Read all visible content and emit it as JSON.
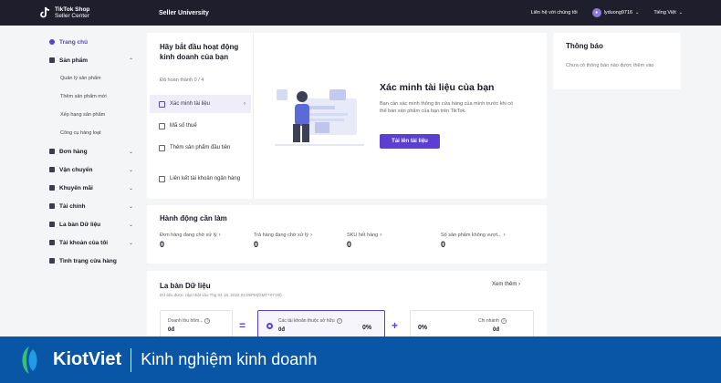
{
  "topbar": {
    "brand_line1": "TikTok Shop",
    "brand_line2": "Seller Center",
    "section": "Seller University",
    "contact": "Liên hệ với chúng tôi",
    "username": "lyduong9716",
    "language": "Tiếng Việt"
  },
  "sidebar": {
    "home": "Trang chủ",
    "products": "Sản phẩm",
    "product_sub": [
      "Quản lý sản phẩm",
      "Thêm sản phẩm mới",
      "Xếp hạng sản phẩm",
      "Công cụ hàng loạt"
    ],
    "orders": "Đơn hàng",
    "shipping": "Vận chuyển",
    "promotions": "Khuyến mãi",
    "finance": "Tài chính",
    "data_compass": "La bàn Dữ liệu",
    "account": "Tài khoản của tôi",
    "shop_health": "Tình trạng cửa hàng"
  },
  "getting_started": {
    "title": "Hãy bắt đầu hoạt động kinh doanh của bạn",
    "progress": "Đã hoàn thành 0 / 4",
    "steps": [
      "Xác minh tài liệu",
      "Mã số thuế",
      "Thêm sản phẩm đầu tiên",
      "Liên kết tài khoản ngân hàng"
    ],
    "verify_title": "Xác minh tài liệu của bạn",
    "verify_desc": "Bạn cần xác minh thông tin cửa hàng của mình trước khi có thể bán sản phẩm của bạn trên TikTok.",
    "upload_button": "Tải lên tài liệu"
  },
  "notice": {
    "title": "Thông báo",
    "body": "Chưa có thông báo nào được thêm vào"
  },
  "actions": {
    "title": "Hành động cần làm",
    "items": [
      {
        "label": "Đơn hàng đang chờ xử lý",
        "value": "0"
      },
      {
        "label": "Trả hàng đang chờ xử lý",
        "value": "0"
      },
      {
        "label": "SKU hết hàng",
        "value": "0"
      },
      {
        "label": "Số sản phẩm không vượt...",
        "value": "0"
      }
    ]
  },
  "compass": {
    "title": "La bàn Dữ liệu",
    "subtitle": "Dữ liệu được cập nhật vào Thg 04 18, 2022 04:05PM(GMT+07:00)",
    "see_more": "Xem thêm",
    "m1_label": "Doanh thu hôm...",
    "m1_value": "0đ",
    "eq": "=",
    "m2_label": "Các tài khoản thuộc sở hữu",
    "m2_value": "0đ",
    "m2_pct": "0%",
    "plus": "+",
    "m3_pct": "0%",
    "m3_label": "Chi nhánh",
    "m3_value": "0đ"
  },
  "banner": {
    "brand": "KiotViet",
    "tagline": "Kinh nghiệm kinh doanh"
  },
  "colors": {
    "accent": "#5b3fd1",
    "topbar": "#1e1e2d",
    "banner": "#0a56a6"
  }
}
